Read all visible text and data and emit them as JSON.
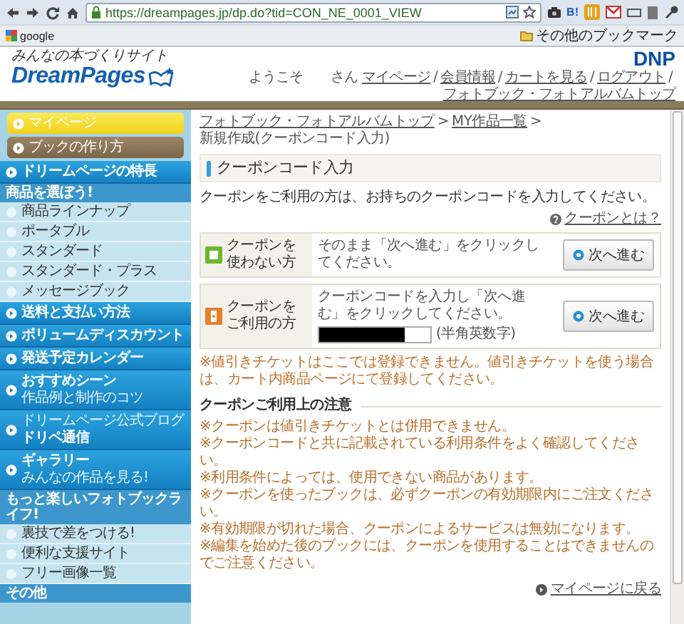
{
  "browser": {
    "url": "https://dreampages.jp/dp.do?tid=CON_NE_0001_VIEW",
    "extension_label": "B!",
    "bookmarks": [
      {
        "label": "google"
      }
    ],
    "other_bookmarks": "その他のブックマーク"
  },
  "header": {
    "tagline": "みんなの本づくりサイト",
    "logo": "DreamPages",
    "brand": "DNP",
    "greeting": "ようこそ",
    "honorific": "さん",
    "separator": "/",
    "nav_links": [
      "マイページ",
      "会員情報",
      "カートを見る",
      "ログアウト",
      "フォトブック・フォトアルバムトップ"
    ]
  },
  "sidebar": {
    "items": [
      {
        "kind": "mypage",
        "label": "マイページ"
      },
      {
        "kind": "guide",
        "label": "ブックの作り方"
      },
      {
        "kind": "main",
        "label": "ドリームページの特長"
      },
      {
        "kind": "section",
        "label": "商品を選ぼう!"
      },
      {
        "kind": "sub",
        "label": "商品ラインナップ"
      },
      {
        "kind": "sub",
        "label": "ポータブル"
      },
      {
        "kind": "sub",
        "label": "スタンダード"
      },
      {
        "kind": "sub",
        "label": "スタンダード・プラス"
      },
      {
        "kind": "sub",
        "label": "メッセージブック"
      },
      {
        "kind": "main",
        "label": "送料と支払い方法"
      },
      {
        "kind": "main",
        "label": "ボリュームディスカウント"
      },
      {
        "kind": "main",
        "label": "発送予定カレンダー"
      },
      {
        "kind": "main",
        "label": "おすすめシーン",
        "subtitle": "作品例と制作のコツ"
      },
      {
        "kind": "main",
        "label": "ドリペ通信",
        "overline": "ドリームページ公式ブログ"
      },
      {
        "kind": "main",
        "label": "ギャラリー",
        "subtitle": "みんなの作品を見る!"
      },
      {
        "kind": "section",
        "label": "もっと楽しいフォトブックライフ!"
      },
      {
        "kind": "sub",
        "label": "裏技で差をつける!"
      },
      {
        "kind": "sub",
        "label": "便利な支援サイト"
      },
      {
        "kind": "sub",
        "label": "フリー画像一覧"
      },
      {
        "kind": "section",
        "label": "その他"
      }
    ]
  },
  "main": {
    "breadcrumb": [
      {
        "label": "フォトブック・フォトアルバムトップ",
        "link": true
      },
      {
        "label": "MY作品一覧",
        "link": true
      },
      {
        "label": "新規作成(クーポンコード入力)",
        "link": false
      }
    ],
    "breadcrumb_separator": ">",
    "title": "クーポンコード入力",
    "intro": "クーポンをご利用の方は、お持ちのクーポンコードを入力してください。",
    "help_link": "クーポンとは？",
    "options": [
      {
        "kind": "skip",
        "label": "クーポンを使わない方",
        "instruction": "そのまま「次へ進む」をクリックしてください。",
        "button": "次へ進む"
      },
      {
        "kind": "coupon",
        "label": "クーポンをご利用の方",
        "instruction": "クーポンコードを入力し「次へ進む」をクリックしてください。",
        "input_hint": "(半角英数字)",
        "button": "次へ進む"
      }
    ],
    "note": "※値引きチケットはここでは登録できません。値引きチケットを使う場合は、カート内商品ページにて登録してください。",
    "notes_title": "クーポンご利用上の注意",
    "notes": [
      "※クーポンは値引きチケットとは併用できません。",
      "※クーポンコードと共に記載されている利用条件をよく確認してください。",
      "※利用条件によっては、使用できない商品があります。",
      "※クーポンを使ったブックは、必ずクーポンの有効期限内にご注文ください。",
      "※有効期限が切れた場合、クーポンによるサービスは無効になります。",
      "※編集を始めた後のブックには、クーポンを使用することはできませんのでご注意ください。"
    ],
    "back_link": "マイページに戻る"
  }
}
